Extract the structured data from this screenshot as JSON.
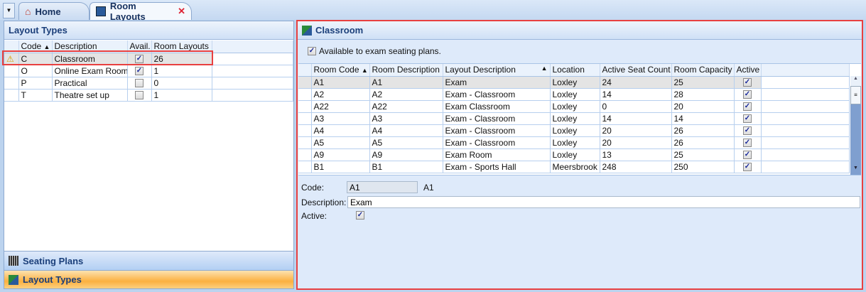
{
  "tabs": [
    {
      "label": "Home",
      "icon": "home-icon"
    },
    {
      "label": "Room Layouts",
      "icon": "room-layout-icon",
      "close": "✕"
    }
  ],
  "left": {
    "title": "Layout Types",
    "columns": [
      "Code",
      "Description",
      "Avail.",
      "Room Layouts"
    ],
    "rows": [
      {
        "code": "C",
        "description": "Classroom",
        "avail": true,
        "room_layouts": "26",
        "warning": true
      },
      {
        "code": "O",
        "description": "Online Exam Room",
        "avail": true,
        "room_layouts": "1"
      },
      {
        "code": "P",
        "description": "Practical",
        "avail": false,
        "room_layouts": "0"
      },
      {
        "code": "T",
        "description": "Theatre set up",
        "avail": false,
        "room_layouts": "1"
      }
    ],
    "nav": [
      {
        "label": "Seating Plans"
      },
      {
        "label": "Layout Types"
      }
    ]
  },
  "right": {
    "title": "Classroom",
    "available_label": "Available to exam seating plans.",
    "available": true,
    "columns": [
      "Room Code",
      "Room Description",
      "Layout Description",
      "Location",
      "Active Seat Count",
      "Room Capacity",
      "Active"
    ],
    "rows": [
      [
        "A1",
        "A1",
        "Exam",
        "Loxley",
        "24",
        "25"
      ],
      [
        "A2",
        "A2",
        "Exam - Classroom",
        "Loxley",
        "14",
        "28"
      ],
      [
        "A22",
        "A22",
        "Exam Classroom",
        "Loxley",
        "0",
        "20"
      ],
      [
        "A3",
        "A3",
        "Exam - Classroom",
        "Loxley",
        "14",
        "14"
      ],
      [
        "A4",
        "A4",
        "Exam - Classroom",
        "Loxley",
        "20",
        "26"
      ],
      [
        "A5",
        "A5",
        "Exam - Classroom",
        "Loxley",
        "20",
        "26"
      ],
      [
        "A9",
        "A9",
        "Exam Room",
        "Loxley",
        "13",
        "25"
      ],
      [
        "B1",
        "B1",
        "Exam - Sports Hall",
        "Meersbrook",
        "248",
        "250"
      ]
    ],
    "detail": {
      "code_label": "Code:",
      "code_value": "A1",
      "code_text": "A1",
      "description_label": "Description:",
      "description_value": "Exam",
      "active_label": "Active:"
    }
  },
  "colors": {
    "highlight": "#e84040",
    "nav_active": "#fbb040"
  }
}
